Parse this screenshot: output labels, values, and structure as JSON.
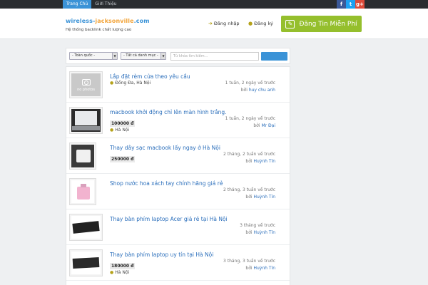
{
  "topnav": {
    "home": "Trang Chủ",
    "about": "Giới Thiệu"
  },
  "social": {
    "facebook": "f",
    "twitter": "t",
    "googleplus": "g+"
  },
  "header": {
    "logo_part1": "wireless-",
    "logo_part2": "jacksonville",
    "logo_part3": ".com",
    "tagline": "Hệ thống backlink chất lượng cao",
    "login": "Đăng nhập",
    "register": "Đăng ký",
    "post_button": "Đăng Tin Miễn Phí"
  },
  "search": {
    "region": "- Toàn quốc -",
    "category": "- Tất cả danh mục -",
    "placeholder": "Từ khóa tìm kiếm..."
  },
  "listings": [
    {
      "title": "Lắp đặt rèm cửa theo yêu cầu",
      "price": "",
      "location": "Đống Đa, Hà Nội",
      "time": "1 tuần, 2 ngày về trước",
      "by_label": "bởi",
      "author": "huy chu anh",
      "thumb": "no-photo",
      "nophoto_text": "no photos"
    },
    {
      "title": "macbook khởi động chỉ lên màn hình trắng.",
      "price": "100000 đ",
      "location": "Hà Nội",
      "time": "1 tuần, 2 ngày về trước",
      "by_label": "bởi",
      "author": "Mr Đại",
      "thumb": "laptop"
    },
    {
      "title": "Thay dây sạc macbook lấy ngay ở Hà Nội",
      "price": "250000 đ",
      "location": "",
      "time": "2 tháng, 2 tuần về trước",
      "by_label": "bởi",
      "author": "Huỳnh Tín",
      "thumb": "charger"
    },
    {
      "title": "Shop nước hoa xách tay chính hãng giá rẻ",
      "price": "",
      "location": "",
      "time": "2 tháng, 3 tuần về trước",
      "by_label": "bởi",
      "author": "Huỳnh Tín",
      "thumb": "perfume"
    },
    {
      "title": "Thay bàn phím laptop Acer giá rẻ tại Hà Nội",
      "price": "",
      "location": "",
      "time": "3 tháng về trước",
      "by_label": "bởi",
      "author": "Huỳnh Tín",
      "thumb": "keyboard"
    },
    {
      "title": "Thay bàn phím laptop uy tín tại Hà Nội",
      "price": "180000 đ",
      "location": "Hà Nội",
      "time": "3 tháng, 3 tuần về trước",
      "by_label": "bởi",
      "author": "Huỳnh Tín",
      "thumb": "keyboard"
    }
  ],
  "colors": {
    "accent": "#3b93d7",
    "cta": "#95bf2d",
    "topbar": "#2a2d30",
    "link": "#2a6ebb"
  }
}
